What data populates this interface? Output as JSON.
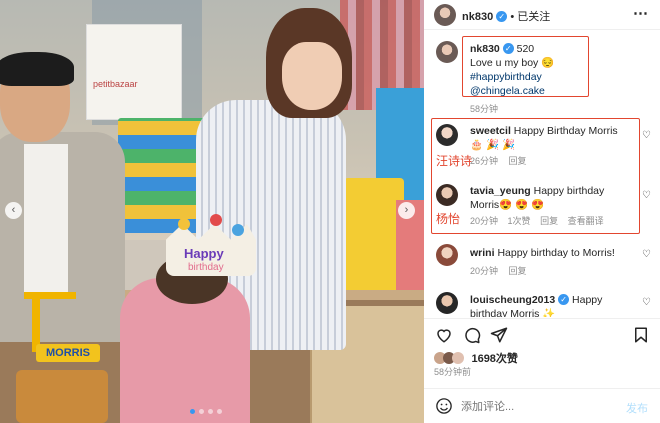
{
  "post": {
    "username": "nk830",
    "follow_status": "已关注",
    "more": "⋯"
  },
  "caption": {
    "username": "nk830",
    "count": "520",
    "line1": "Love u my boy 😔",
    "hashtag": "#happybirthday",
    "mention": "@chingela.cake",
    "time": "58分钟"
  },
  "comments": [
    {
      "username": "sweetcil",
      "text": "Happy Birthday Morris",
      "emoji": "🎂 🎉 🎉",
      "time": "26分钟",
      "reply": "回复",
      "annotation": "汪诗诗"
    },
    {
      "username": "tavia_yeung",
      "text": "Happy birthday",
      "text2": "Morris😍 😍 😍",
      "time": "20分钟",
      "likes": "1次赞",
      "reply": "回复",
      "translate": "查看翻译",
      "annotation": "杨怡"
    },
    {
      "username": "wrini",
      "text": "Happy birthday to Morris!",
      "time": "20分钟",
      "reply": "回复"
    },
    {
      "username": "louischeung2013",
      "text": "Happy",
      "text2": "birthday Morris ✨"
    }
  ],
  "likes": {
    "count": "1698次赞",
    "time": "58分钟前"
  },
  "comment_box": {
    "placeholder": "添加评论...",
    "post_label": "发布"
  },
  "photo": {
    "bag_brand": "petitbazaar",
    "crown_line1": "Happy",
    "crown_line2": "birthday",
    "cake_label": "MORRIS",
    "nav_prev": "‹",
    "nav_next": "›"
  },
  "colors": {
    "accent": "#3897f0",
    "annotation_red": "#e2462f"
  }
}
